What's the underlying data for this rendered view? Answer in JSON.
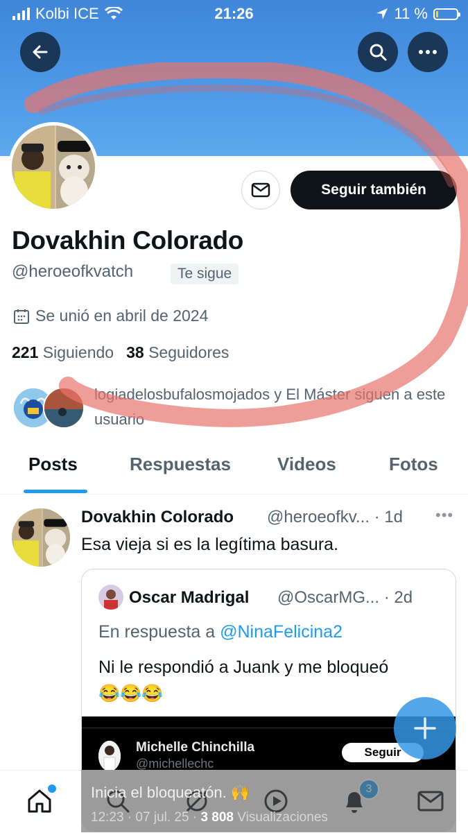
{
  "status_bar": {
    "carrier": "Kolbi ICE",
    "time": "21:26",
    "battery": "11 %"
  },
  "profile": {
    "name": "Dovakhin Colorado",
    "handle": "@heroeofkvatch",
    "follows_you": "Te sigue",
    "joined": "Se unió en abril de 2024",
    "following_count": "221",
    "following_label": "Siguiendo",
    "followers_count": "38",
    "followers_label": "Seguidores",
    "follow_button": "Seguir también",
    "mutuals_text": "logiadelosbufalosmojados y El Máster siguen a este usuario"
  },
  "tabs": [
    "Posts",
    "Respuestas",
    "Videos",
    "Fotos"
  ],
  "tweet": {
    "name": "Dovakhin Colorado",
    "handle": "@heroeofkv...",
    "time": "· 1d",
    "text": "Esa vieja si es la legítima basura.",
    "quote": {
      "name": "Oscar Madrigal",
      "handle": "@OscarMG...",
      "time": "· 2d",
      "reply_prefix": "En respuesta a",
      "reply_to": "@NinaFelicina2",
      "text": "Ni le respondió a Juank y me bloqueó",
      "emojis": "😂😂😂",
      "media": {
        "name": "Michelle Chinchilla",
        "handle": "@michellechc",
        "follow": "Seguir"
      }
    }
  },
  "overlay": {
    "text": "Inicia el bloqueatón. 🙌",
    "meta_prefix": "12:23 · 07 jul. 25 ·",
    "views": "3 808",
    "views_label": "Visualizaciones"
  },
  "nav": {
    "notifications_badge": "3"
  },
  "colors": {
    "accent": "#1d9bf0",
    "banner": "#4e98e6",
    "scribble": "#e8746c"
  }
}
